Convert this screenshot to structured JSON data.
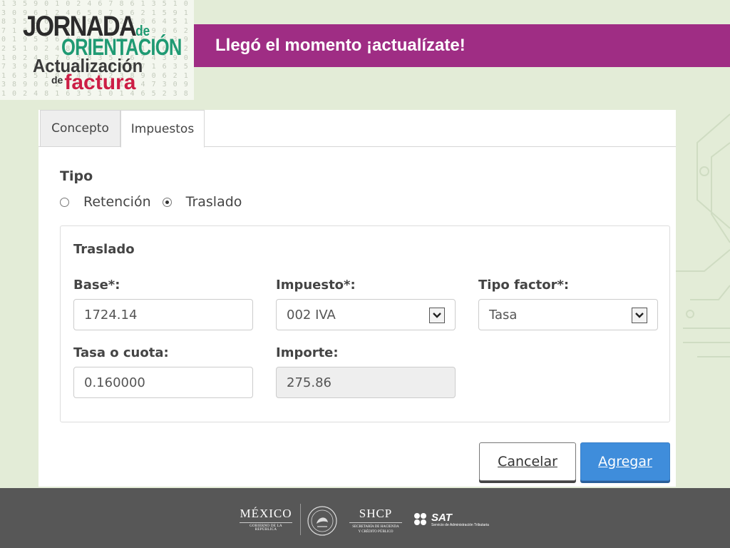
{
  "logo": {
    "line1": "JORNADA",
    "line1_suffix": "de",
    "line2": "ORIENTACIÓN",
    "line3": "Actualización",
    "line4_prefix": "de",
    "line4": "factura"
  },
  "banner": {
    "text": "Llegó el momento ¡actualízate!"
  },
  "tabs": [
    {
      "label": "Concepto",
      "active": false
    },
    {
      "label": "Impuestos",
      "active": true
    }
  ],
  "tipo": {
    "label": "Tipo",
    "options": [
      {
        "label": "Retención",
        "checked": false
      },
      {
        "label": "Traslado",
        "checked": true
      }
    ]
  },
  "traslado": {
    "title": "Traslado",
    "fields": {
      "base": {
        "label": "Base*:",
        "value": "1724.14"
      },
      "impuesto": {
        "label": "Impuesto*:",
        "value": "002 IVA"
      },
      "tipo_factor": {
        "label": "Tipo factor*:",
        "value": "Tasa"
      },
      "tasa_cuota": {
        "label": "Tasa o cuota:",
        "value": "0.160000"
      },
      "importe": {
        "label": "Importe:",
        "value": "275.86"
      }
    }
  },
  "buttons": {
    "cancel": "Cancelar",
    "add": "Agregar"
  },
  "footer": {
    "mexico": "MÉXICO",
    "mexico_sub": "GOBIERNO DE LA REPÚBLICA",
    "shcp": "SHCP",
    "shcp_sub1": "SECRETARÍA DE HACIENDA",
    "shcp_sub2": "Y CRÉDITO PÚBLICO",
    "sat": "SAT",
    "sat_sub": "Servicio de Administración Tributaria"
  },
  "colors": {
    "banner": "#9f2d84",
    "accent_green": "#1f9a73",
    "accent_red": "#cc1e45",
    "primary_button": "#3f8ddb",
    "footer": "#575757",
    "page_bg": "#e3ecd7"
  },
  "icons": {
    "select_arrow": "chevron-down-icon",
    "seal": "national-seal-icon",
    "sat_logo": "sat-logo-icon"
  }
}
